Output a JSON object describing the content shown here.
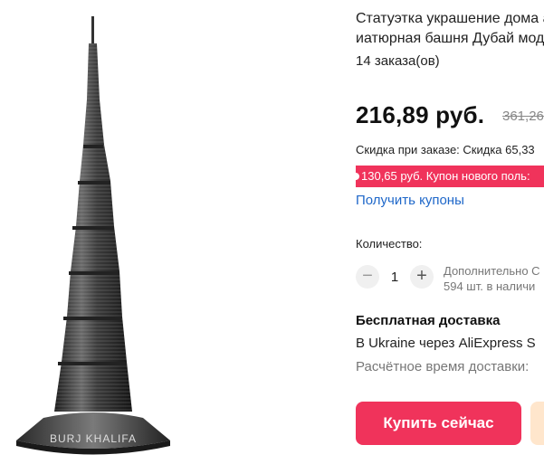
{
  "product": {
    "title_line1": "Статуэтка украшение дома а",
    "title_line2": "иатюрная башня Дубай мод",
    "orders": "14 заказа(ов)",
    "image_label": "BURJ KHALIFA"
  },
  "price": {
    "current": "216,89 руб.",
    "old": "361,26"
  },
  "discount_text": "Скидка при заказе: Скидка 65,33",
  "coupon_text": "130,65 руб. Купон нового поль:",
  "get_coupons_label": "Получить купоны",
  "quantity": {
    "label": "Количество:",
    "minus": "−",
    "value": "1",
    "plus": "+",
    "stock_line1": "Дополнительно С",
    "stock_line2": "594 шт. в наличи"
  },
  "shipping": {
    "title": "Бесплатная доставка",
    "via": "В Ukraine через AliExpress S",
    "time": "Расчётное время доставки:"
  },
  "buy_label": "Купить сейчас",
  "colors": {
    "accent": "#f0335b",
    "link": "#1e67c9",
    "cart_bg": "#ffe6cc"
  }
}
